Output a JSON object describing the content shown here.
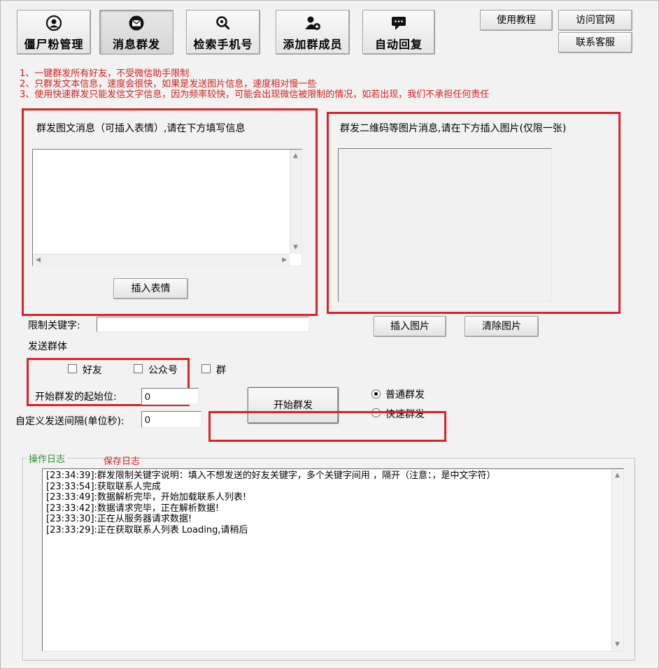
{
  "toolbar": {
    "buttons": [
      {
        "label": "僵尸粉管理",
        "icon": "user-circle-icon"
      },
      {
        "label": "消息群发",
        "icon": "envelope-icon",
        "active": true
      },
      {
        "label": "检索手机号",
        "icon": "search-icon"
      },
      {
        "label": "添加群成员",
        "icon": "add-user-icon"
      },
      {
        "label": "自动回复",
        "icon": "chat-bubble-icon"
      }
    ],
    "tutorial": "使用教程",
    "website": "访问官网",
    "support": "联系客服"
  },
  "notes": [
    "1、一键群发所有好友，不受微信助手限制",
    "2、只群发文本信息，速度会很快，如果是发送图片信息，速度相对慢一些",
    "3、使用快速群发只能发信文字信息，因为频率较快，可能会出现微信被限制的情况，如若出现，我们不承担任何责任"
  ],
  "text_message": {
    "title": "群发图文消息（可插入表情）,请在下方填写信息",
    "value": "",
    "insert_emoji": "插入表情"
  },
  "image_message": {
    "title": "群发二维码等图片消息,请在下方插入图片(仅限一张)",
    "insert_image": "插入图片",
    "clear_image": "清除图片"
  },
  "keyword": {
    "label": "限制关键字:",
    "value": ""
  },
  "targets": {
    "label": "发送群体",
    "friends": {
      "label": "好友",
      "checked": false
    },
    "official": {
      "label": "公众号",
      "checked": false
    },
    "groups": {
      "label": "群",
      "checked": false
    }
  },
  "start_position": {
    "label": "开始群发的起始位:",
    "value": "0"
  },
  "interval": {
    "label": "自定义发送间隔(单位秒):",
    "value": "0"
  },
  "start_button": "开始群发",
  "mode": {
    "normal": {
      "label": "普通群发",
      "selected": true
    },
    "fast": {
      "label": "快速群发",
      "selected": false
    }
  },
  "log": {
    "title": "操作日志",
    "save": "保存日志",
    "lines": [
      "[23:34:39]:群发限制关键字说明：填入不想发送的好友关键字，多个关键字间用 ，隔开（注意：，是中文字符）",
      "[23:33:54]:获取联系人完成",
      "[23:33:49]:数据解析完毕，开始加载联系人列表!",
      "[23:33:42]:数据请求完毕，正在解析数据!",
      "[23:33:30]:正在从服务器请求数据!",
      "[23:33:29]:正在获取联系人列表 Loading,请稍后"
    ]
  },
  "colors": {
    "annotation_red": "#d9232a",
    "note_red": "#d02020",
    "log_title_green": "#2f8a2f"
  }
}
